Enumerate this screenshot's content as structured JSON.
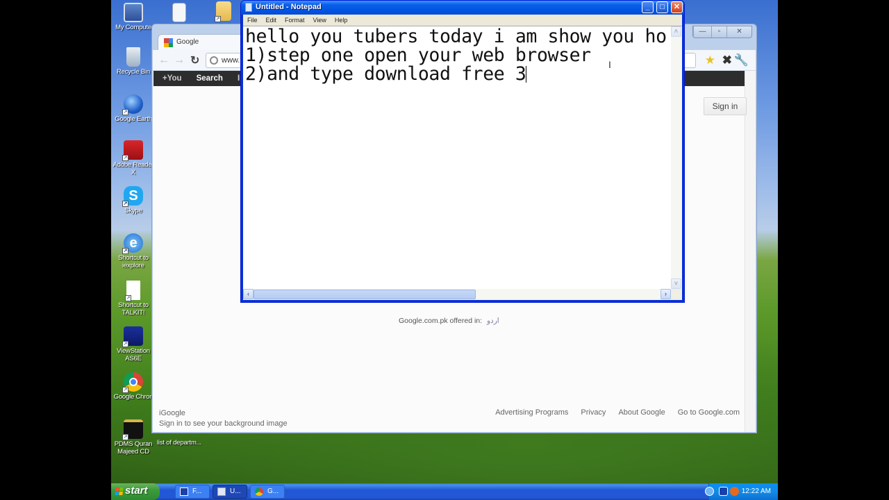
{
  "desktop": {
    "icons": [
      {
        "label": "My Compute",
        "icon": "my-computer-icon"
      },
      {
        "label": "Recycle Bin",
        "icon": "recycle-bin-icon"
      },
      {
        "label": "Google Earth",
        "icon": "google-earth-icon"
      },
      {
        "label": "Adobe Reader X",
        "icon": "adobe-reader-icon"
      },
      {
        "label": "Skype",
        "icon": "skype-icon"
      },
      {
        "label": "Shortcut to iexplore",
        "icon": "internet-explorer-icon"
      },
      {
        "label": "Shortcut to TALKIT!",
        "icon": "document-icon"
      },
      {
        "label": "ViewStation AS6E",
        "icon": "scanner-icon"
      },
      {
        "label": "Google Chron",
        "icon": "chrome-icon"
      },
      {
        "label": "PDMS Quran Majeed CD",
        "icon": "quran-icon"
      },
      {
        "label": "list of departm...",
        "icon": "file-icon"
      }
    ]
  },
  "chrome": {
    "tab_title": "Google",
    "url": "www.",
    "caption": {
      "minimize": "—",
      "restore": "▫",
      "close": "✕"
    },
    "gbar": [
      "+You",
      "Search",
      "Ima"
    ],
    "signin_label": "Sign in",
    "offered_in_label": "Google.com.pk offered in:",
    "offered_in_language": "اردو",
    "footer_left": {
      "title": "iGoogle",
      "subtitle": "Sign in to see your background image"
    },
    "footer_links": [
      "Advertising Programs",
      "Privacy",
      "About Google",
      "Go to Google.com"
    ]
  },
  "notepad": {
    "title": "Untitled - Notepad",
    "menu": [
      "File",
      "Edit",
      "Format",
      "View",
      "Help"
    ],
    "lines": [
      "hello you tubers today i am show you ho",
      "1)step one open your web browser",
      "2)and type download free 3"
    ],
    "buttons": {
      "minimize": "_",
      "maximize": "□",
      "close": "✕"
    },
    "scroll": {
      "horizontal_thumb_fraction": 0.55
    }
  },
  "taskbar": {
    "start_label": "start",
    "tasks": [
      {
        "label": "F...",
        "icon": "app-window-icon",
        "active": false
      },
      {
        "label": "U...",
        "icon": "notepad-icon",
        "active": true
      },
      {
        "label": "G...",
        "icon": "chrome-icon",
        "active": false
      }
    ],
    "clock": "12:22 AM"
  },
  "colors": {
    "xp_blue": "#0054e3",
    "start_green": "#3c9b3c",
    "close_red": "#e0502a",
    "gbar_black": "#2d2d2d"
  }
}
